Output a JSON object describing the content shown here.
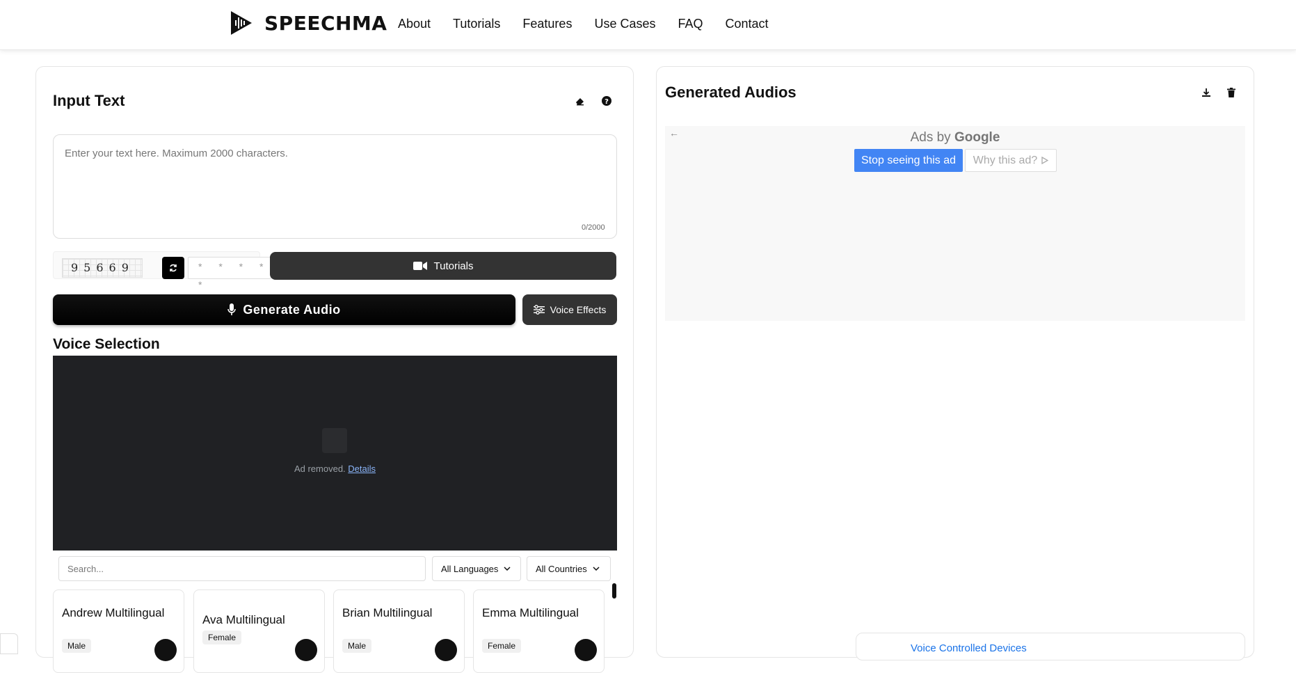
{
  "header": {
    "brand": "SPEECHMA",
    "nav": [
      "About",
      "Tutorials",
      "Features",
      "Use Cases",
      "FAQ",
      "Contact"
    ]
  },
  "input_panel": {
    "title": "Input Text",
    "textarea_placeholder": "Enter your text here. Maximum 2000 characters.",
    "char_count": "0/2000",
    "captcha_code": "95669",
    "captcha_input_placeholder": "* * * * *",
    "tutorials_label": "Tutorials",
    "generate_label": "Generate Audio",
    "effects_label": "Voice Effects"
  },
  "voice_selection": {
    "title": "Voice Selection",
    "ad_removed_text": "Ad removed.",
    "ad_details_link": "Details",
    "search_placeholder": "Search...",
    "language_select": "All Languages",
    "country_select": "All Countries",
    "voices": [
      {
        "name": "Andrew Multilingual",
        "gender": "Male"
      },
      {
        "name": "Ava Multilingual",
        "gender": "Female"
      },
      {
        "name": "Brian Multilingual",
        "gender": "Male"
      },
      {
        "name": "Emma Multilingual",
        "gender": "Female"
      }
    ]
  },
  "generated_panel": {
    "title": "Generated Audios",
    "ads_by": "Ads by",
    "ads_brand": "Google",
    "stop_ad": "Stop seeing this ad",
    "why_ad": "Why this ad?",
    "corner_text": "Voice Controlled Devices"
  },
  "colors": {
    "primary": "#000000",
    "secondary_button": "#333333",
    "ad_blue": "#4285f4",
    "dark_ad_bg": "#202124"
  }
}
